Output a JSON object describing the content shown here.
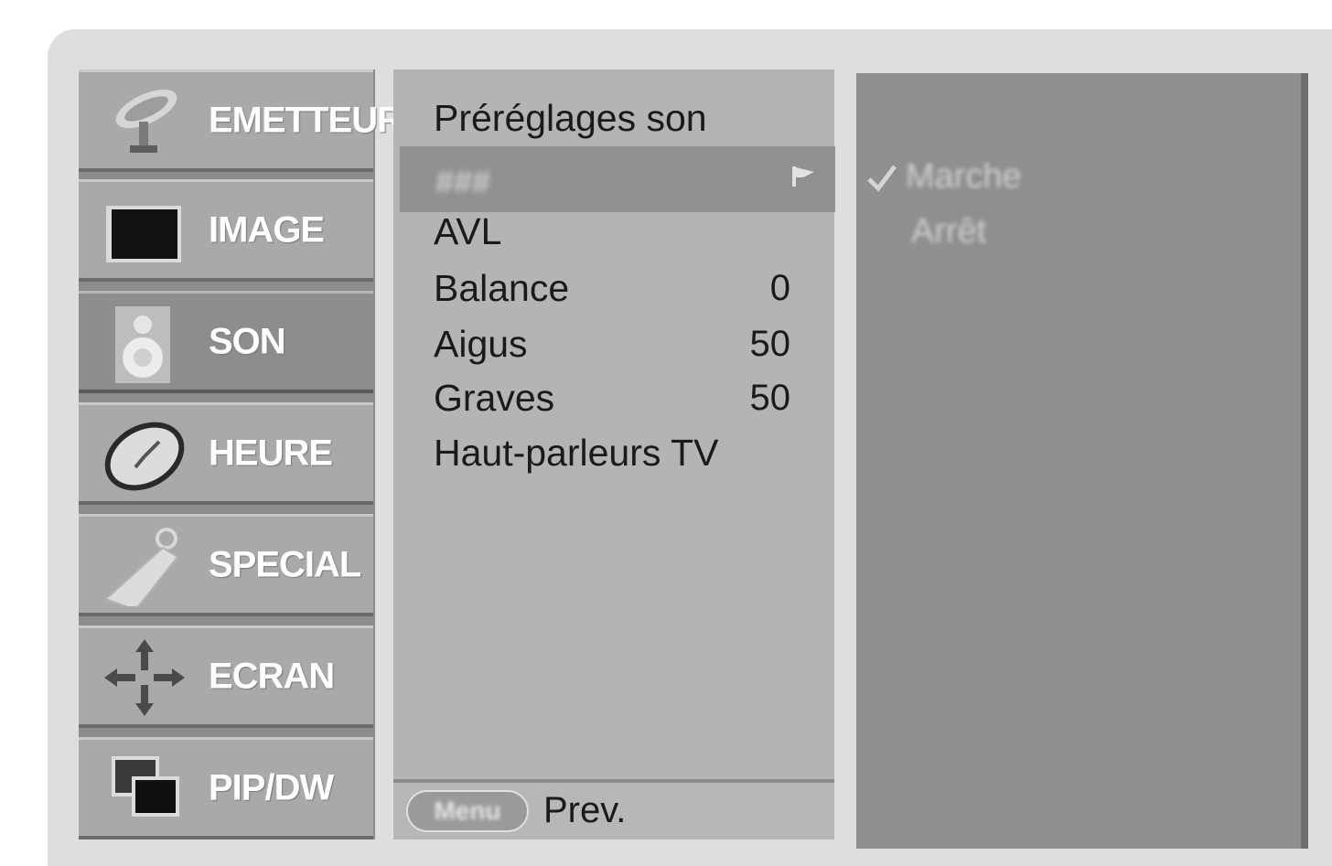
{
  "sidebar": {
    "items": [
      {
        "label": "EMETTEUR",
        "icon": "satellite-dish-icon"
      },
      {
        "label": "IMAGE",
        "icon": "tv-screen-icon"
      },
      {
        "label": "SON",
        "icon": "speaker-icon",
        "active": true
      },
      {
        "label": "HEURE",
        "icon": "clock-icon"
      },
      {
        "label": "SPECIAL",
        "icon": "key-tag-icon"
      },
      {
        "label": "ECRAN",
        "icon": "move-arrows-icon"
      },
      {
        "label": "PIP/DW",
        "icon": "pip-windows-icon"
      }
    ]
  },
  "submenu": {
    "items": [
      {
        "label": "Préréglages son",
        "value": ""
      },
      {
        "label": "AVL",
        "value": ""
      },
      {
        "label": "Balance",
        "value": "0"
      },
      {
        "label": "Aigus",
        "value": "50"
      },
      {
        "label": "Graves",
        "value": "50"
      },
      {
        "label": "Haut-parleurs TV",
        "value": ""
      }
    ],
    "highlighted_label": "###",
    "footer": {
      "menu_button": "Menu",
      "prev_label": "Prev."
    }
  },
  "options": {
    "items": [
      "Marche",
      "Arrêt"
    ],
    "selected": "Marche"
  },
  "colors": {
    "frame": "#dedede",
    "sidebar_tile": "#a9a9a9",
    "sidebar_active": "#8d8d8d",
    "submenu_bg": "#b4b4b4",
    "highlight": "#909090",
    "options_bg": "#8f8f8f"
  }
}
